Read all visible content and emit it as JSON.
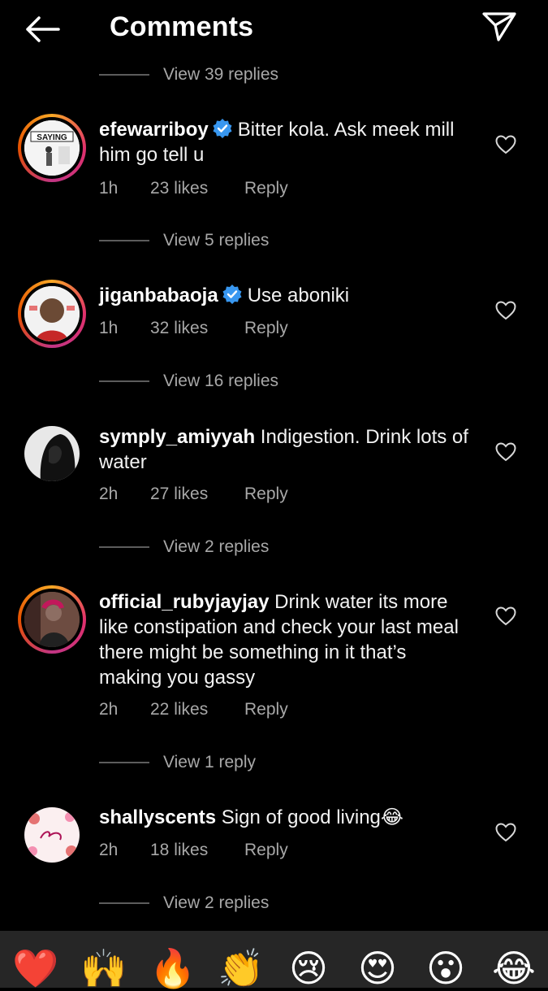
{
  "header": {
    "title": "Comments"
  },
  "top_replies": "View 39 replies",
  "comments": [
    {
      "username": "efewarriboy",
      "verified": true,
      "text": "Bitter kola. Ask meek mill him go tell u",
      "time": "1h",
      "likes": "23 likes",
      "reply": "Reply",
      "view_replies": "View 5 replies",
      "avatar_caption": "SAYING"
    },
    {
      "username": "jiganbabaoja",
      "verified": true,
      "text": "Use aboniki",
      "time": "1h",
      "likes": "32 likes",
      "reply": "Reply",
      "view_replies": "View 16 replies"
    },
    {
      "username": "symply_amiyyah",
      "verified": false,
      "text": "Indigestion. Drink lots of water",
      "time": "2h",
      "likes": "27 likes",
      "reply": "Reply",
      "view_replies": "View 2 replies"
    },
    {
      "username": "official_rubyjayjay",
      "verified": false,
      "text": "Drink water its more like constipation and check your last meal there might be something in it that’s making you gassy",
      "time": "2h",
      "likes": "22 likes",
      "reply": "Reply",
      "view_replies": "View 1 reply"
    },
    {
      "username": "shallyscents",
      "verified": false,
      "text": "Sign of good living😂",
      "time": "2h",
      "likes": "18 likes",
      "reply": "Reply",
      "view_replies": "View 2 replies"
    }
  ],
  "emoji_bar": [
    "❤️",
    "🙌",
    "🔥",
    "👏",
    "😢",
    "😍",
    "😮",
    "😂"
  ],
  "colors": {
    "background": "#000000",
    "secondary_text": "#a8a8a8",
    "verified_blue": "#3897f0",
    "emoji_bar_bg": "#262626"
  }
}
